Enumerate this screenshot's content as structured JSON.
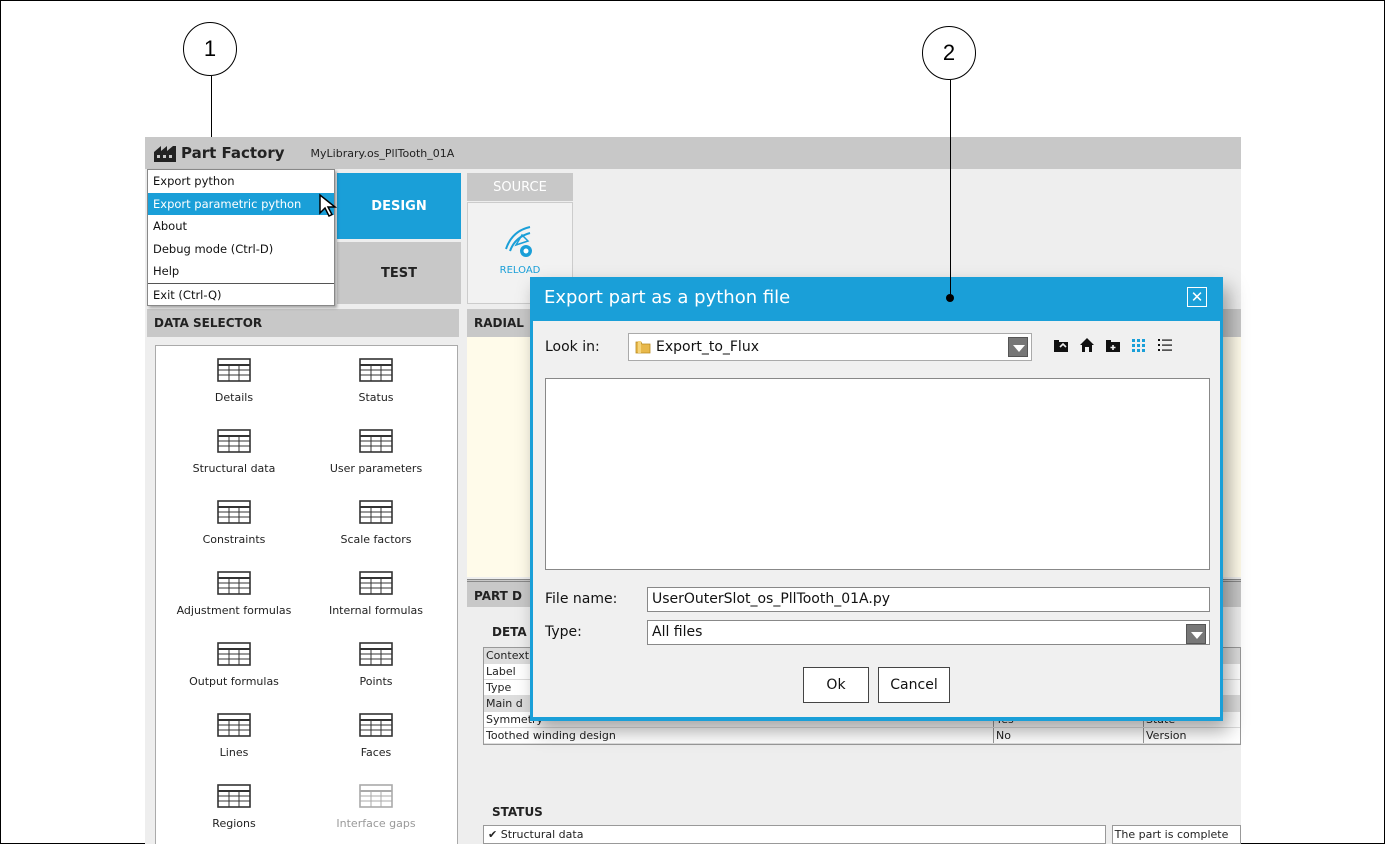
{
  "callouts": [
    "1",
    "2"
  ],
  "app": {
    "name": "Part Factory",
    "file": "MyLibrary.os_PllTooth_01A"
  },
  "menu": {
    "items": [
      "Export python",
      "Export parametric python",
      "About",
      "Debug mode (Ctrl-D)",
      "Help",
      "Exit (Ctrl-Q)"
    ],
    "active_index": 1
  },
  "tabs": {
    "design": "DESIGN",
    "test": "TEST"
  },
  "source": {
    "title": "SOURCE",
    "reload": "RELOAD"
  },
  "data_selector": {
    "title": "DATA SELECTOR",
    "items": [
      "Details",
      "Status",
      "Structural data",
      "User parameters",
      "Constraints",
      "Scale factors",
      "Adjustment formulas",
      "Internal formulas",
      "Output formulas",
      "Points",
      "Lines",
      "Faces",
      "Regions",
      "Interface gaps"
    ]
  },
  "radial": {
    "title": "RADIAL"
  },
  "part_details": {
    "title": "PART D",
    "section": "DETA",
    "rows": [
      [
        "Context",
        "",
        ""
      ],
      [
        "Label",
        "",
        ""
      ],
      [
        "Type",
        "",
        ""
      ],
      [
        "Main d",
        "",
        ""
      ],
      [
        "Symmetry",
        "Yes",
        "State"
      ],
      [
        "Toothed winding design",
        "No",
        "Version"
      ]
    ]
  },
  "status": {
    "title": "STATUS",
    "check": "✔",
    "row_label": "Structural data",
    "row_value": "The part is complete"
  },
  "dialog": {
    "title": "Export part as a python file",
    "close_glyph": "✕",
    "look_in_label": "Look in:",
    "look_in_value": "Export_to_Flux",
    "file_name_label": "File name:",
    "file_name_value": "UserOuterSlot_os_PllTooth_01A.py",
    "type_label": "Type:",
    "type_value": "All files",
    "ok": "Ok",
    "cancel": "Cancel"
  },
  "colors": {
    "accent": "#1a9fd8",
    "header_gray": "#c8c8c8",
    "radial_bg": "#fffbea"
  }
}
